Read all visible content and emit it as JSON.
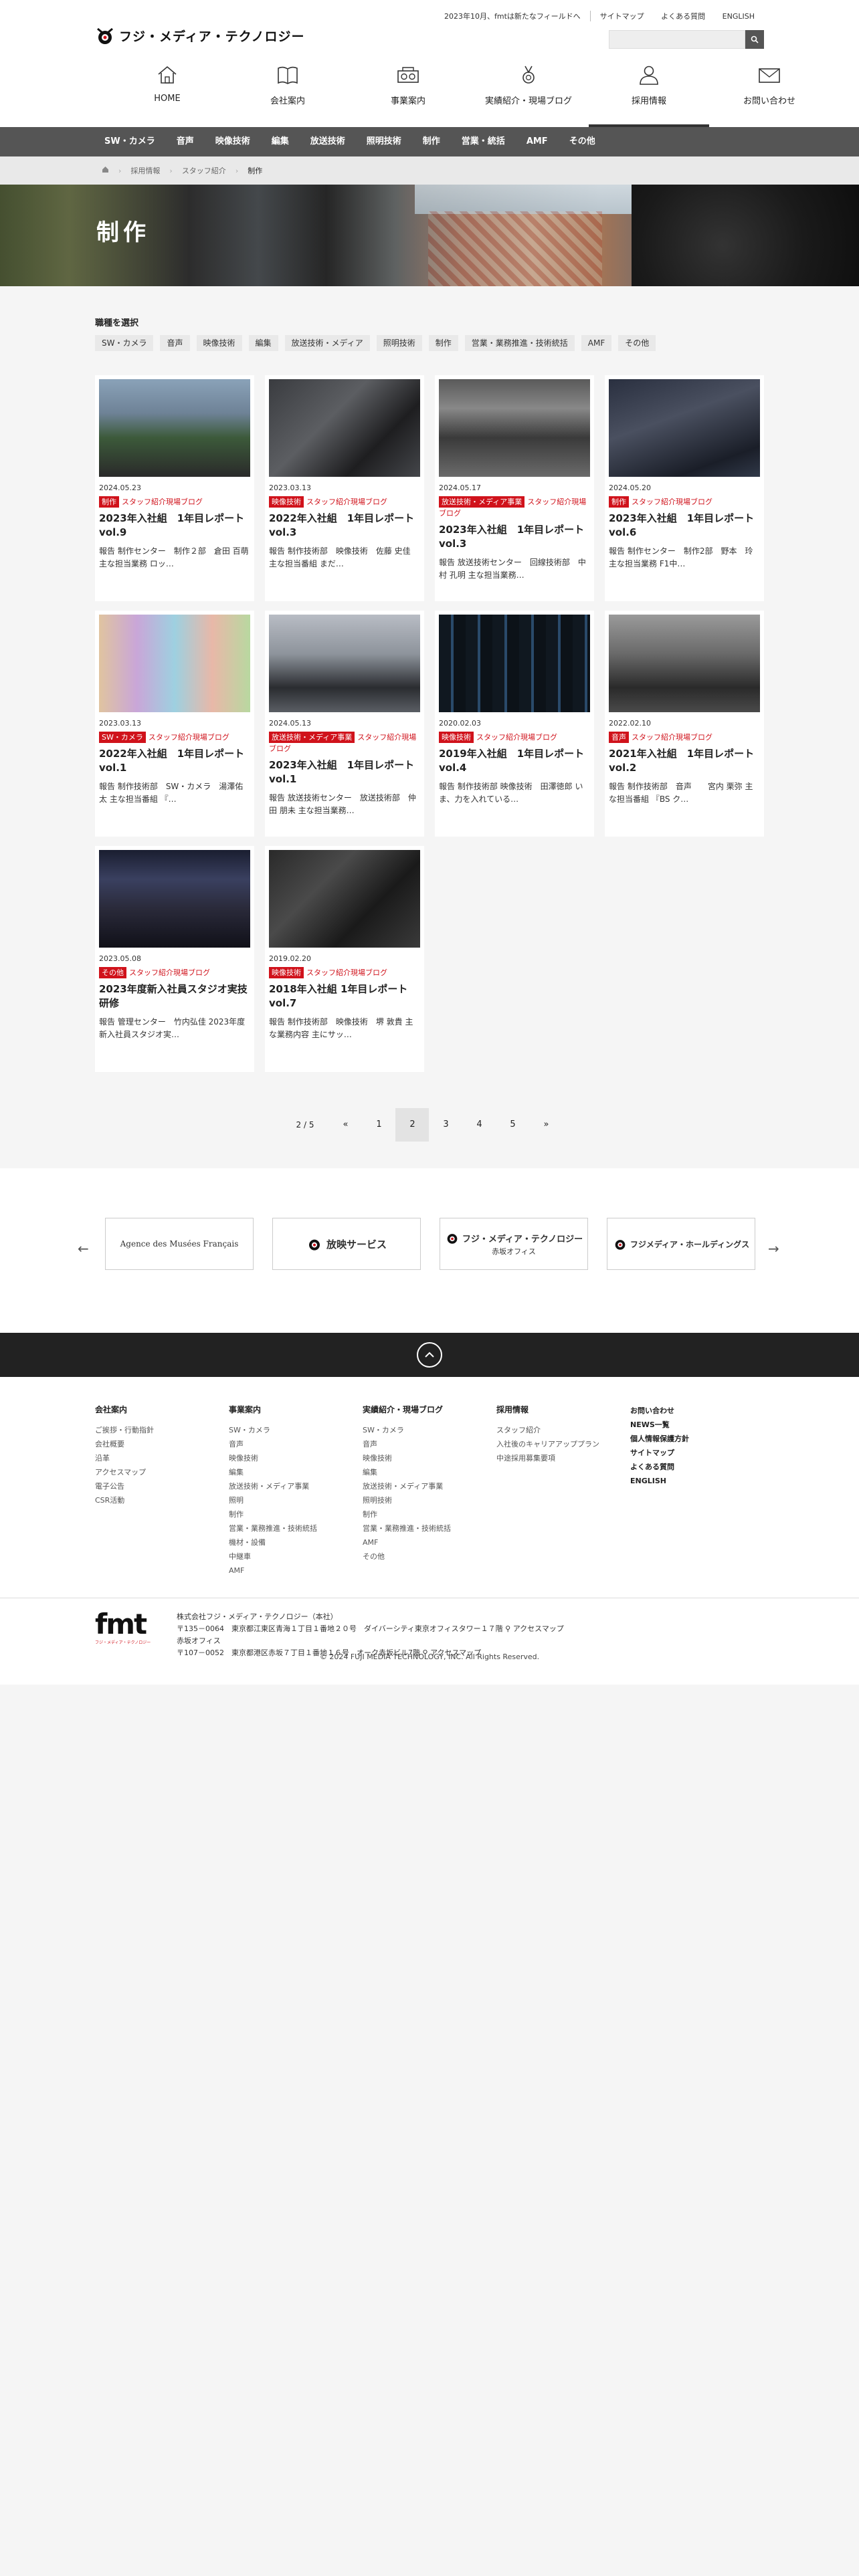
{
  "topbar": {
    "news": "2023年10月、fmtは新たなフィールドへ",
    "links": [
      "サイトマップ",
      "よくある質問",
      "ENGLISH"
    ]
  },
  "logo": {
    "text": "フジ・メディア・テクノロジー"
  },
  "search": {
    "placeholder": ""
  },
  "nav": [
    {
      "label": "HOME",
      "icon": "home-icon"
    },
    {
      "label": "会社案内",
      "icon": "book-icon"
    },
    {
      "label": "事業案内",
      "icon": "equipment-icon"
    },
    {
      "label": "実績紹介・現場ブログ",
      "icon": "medal-icon"
    },
    {
      "label": "採用情報",
      "icon": "person-icon",
      "active": true
    },
    {
      "label": "お問い合わせ",
      "icon": "mail-icon"
    }
  ],
  "subnav": [
    "SW・カメラ",
    "音声",
    "映像技術",
    "編集",
    "放送技術",
    "照明技術",
    "制作",
    "営業・統括",
    "AMF",
    "その他"
  ],
  "breadcrumb": [
    "採用情報",
    "スタッフ紹介",
    "制作"
  ],
  "hero": {
    "title": "制作"
  },
  "filter": {
    "title": "職種を選択",
    "items": [
      "SW・カメラ",
      "音声",
      "映像技術",
      "編集",
      "放送技術・メディア",
      "照明技術",
      "制作",
      "営業・業務推進・技術統括",
      "AMF",
      "その他"
    ]
  },
  "cards": [
    {
      "date": "2024.05.23",
      "tag": "制作",
      "tag2": "スタッフ紹介現場ブログ",
      "title": "2023年入社組　1年目レポート vol.9",
      "desc": "報告 制作センター　制作２部　倉田 百萌 主な担当業務 ロッ…"
    },
    {
      "date": "2023.03.13",
      "tag": "映像技術",
      "tag2": "スタッフ紹介現場ブログ",
      "title": "2022年入社組　1年目レポート vol.3",
      "desc": "報告 制作技術部　映像技術　佐藤 史佳 主な担当番組 まだ…"
    },
    {
      "date": "2024.05.17",
      "tag": "放送技術・メディア事業",
      "tag2": "スタッフ紹介現場ブログ",
      "title": "2023年入社組　1年目レポート vol.3",
      "desc": "報告 放送技術センター　回線技術部　中村 孔明 主な担当業務…"
    },
    {
      "date": "2024.05.20",
      "tag": "制作",
      "tag2": "スタッフ紹介現場ブログ",
      "title": "2023年入社組　1年目レポート vol.6",
      "desc": "報告 制作センター　制作2部　野本　玲 主な担当業務 F1中…"
    },
    {
      "date": "2023.03.13",
      "tag": "SW・カメラ",
      "tag2": "スタッフ紹介現場ブログ",
      "title": "2022年入社組　1年目レポート vol.1",
      "desc": "報告 制作技術部　SW・カメラ　湯澤佑太 主な担当番組 『…"
    },
    {
      "date": "2024.05.13",
      "tag": "放送技術・メディア事業",
      "tag2": "スタッフ紹介現場ブログ",
      "title": "2023年入社組　1年目レポート vol.1",
      "desc": "報告 放送技術センター　放送技術部　仲田 朋未 主な担当業務…"
    },
    {
      "date": "2020.02.03",
      "tag": "映像技術",
      "tag2": "スタッフ紹介現場ブログ",
      "title": "2019年入社組　1年目レポート vol.4",
      "desc": "報告 制作技術部 映像技術　田澤徳郎 いま、力を入れている…"
    },
    {
      "date": "2022.02.10",
      "tag": "音声",
      "tag2": "スタッフ紹介現場ブログ",
      "title": "2021年入社組　1年目レポート vol.2",
      "desc": "報告 制作技術部　音声　　宮内 栗弥 主な担当番組 『BS ク…"
    },
    {
      "date": "2023.05.08",
      "tag": "その他",
      "tag2": "スタッフ紹介現場ブログ",
      "title": "2023年度新入社員スタジオ実技研修",
      "desc": "報告 管理センター　竹内弘佳 2023年度新入社員スタジオ実…"
    },
    {
      "date": "2019.02.20",
      "tag": "映像技術",
      "tag2": "スタッフ紹介現場ブログ",
      "title": "2018年入社組 1年目レポート vol.7",
      "desc": "報告 制作技術部　映像技術　堺 敦貴 主な業務内容 主にサッ…"
    }
  ],
  "pager": {
    "count": "2 / 5",
    "prev": "«",
    "pages": [
      "1",
      "2",
      "3",
      "4",
      "5"
    ],
    "current": "2",
    "next": "»"
  },
  "banners": [
    {
      "label": "Agence des Musées Français"
    },
    {
      "label": "放映サービス"
    },
    {
      "label": "フジ・メディア・テクノロジー",
      "sub": "赤坂オフィス"
    },
    {
      "label": "フジメディア・ホールディングス"
    }
  ],
  "footer": {
    "col1": {
      "title": "会社案内",
      "links": [
        "ご挨拶・行動指針",
        "会社概要",
        "沿革",
        "アクセスマップ",
        "電子公告",
        "CSR活動"
      ]
    },
    "col2": {
      "title": "事業案内",
      "links": [
        "SW・カメラ",
        "音声",
        "映像技術",
        "編集",
        "放送技術・メディア事業",
        "照明",
        "制作",
        "営業・業務推進・技術統括",
        "機材・設備",
        "中継車",
        "AMF"
      ]
    },
    "col3": {
      "title": "実績紹介・現場ブログ",
      "links": [
        "SW・カメラ",
        "音声",
        "映像技術",
        "編集",
        "放送技術・メディア事業",
        "照明技術",
        "制作",
        "営業・業務推進・技術統括",
        "AMF",
        "その他"
      ]
    },
    "col4": {
      "title": "採用情報",
      "links": [
        "スタッフ紹介",
        "入社後のキャリアアッププラン",
        "中途採用募集要項"
      ]
    },
    "col5": {
      "links": [
        "お問い合わせ",
        "NEWS一覧",
        "個人情報保護方針",
        "サイトマップ",
        "よくある質問",
        "ENGLISH"
      ]
    },
    "company": {
      "mark": "fmt",
      "mark_sub": "フジ・メディア・テクノロジー",
      "name": "株式会社フジ・メディア・テクノロジー（本社）",
      "addr1": "〒135－0064　東京都江東区青海１丁目１番地２０号　ダイバーシティ東京オフィスタワー１７階",
      "map1": "アクセスマップ",
      "office": "赤坂オフィス",
      "addr2": "〒107－0052　東京都港区赤坂７丁目１番地１６号　オーク赤坂ビル7階",
      "map2": "アクセスマップ"
    },
    "copyright": "© 2024 FUJI MEDIA TECHNOLOGY, INC. All Rights Reserved."
  },
  "colors": {
    "accent": "#d0121b",
    "subnav": "#555555",
    "dark": "#222222"
  }
}
